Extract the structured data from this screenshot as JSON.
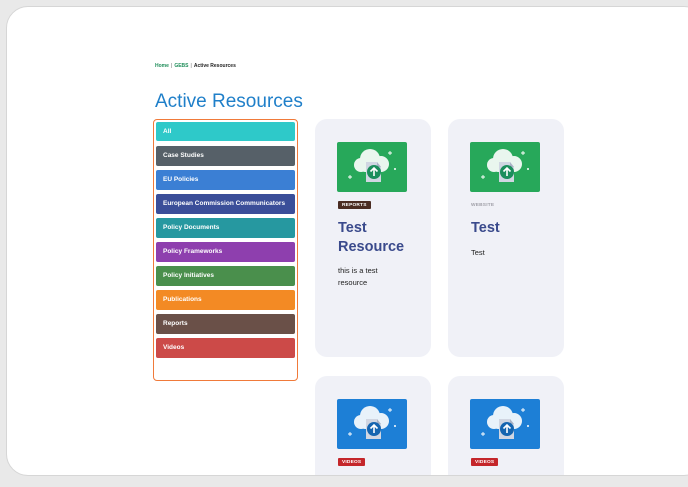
{
  "breadcrumb": {
    "home": "Home",
    "section": "GEBS",
    "current": "Active Resources",
    "separator": "|"
  },
  "page": {
    "title": "Active Resources"
  },
  "filters": [
    {
      "label": "All",
      "color": "#2ec9c9"
    },
    {
      "label": "Case Studies",
      "color": "#566068"
    },
    {
      "label": "EU Policies",
      "color": "#3b7fd4"
    },
    {
      "label": "European Commission Communicators",
      "color": "#3b4e99"
    },
    {
      "label": "Policy Documents",
      "color": "#2698a0"
    },
    {
      "label": "Policy Frameworks",
      "color": "#8e3fae"
    },
    {
      "label": "Policy Initiatives",
      "color": "#4a8f4c"
    },
    {
      "label": "Publications",
      "color": "#f38a24"
    },
    {
      "label": "Reports",
      "color": "#6a5048"
    },
    {
      "label": "Videos",
      "color": "#cc4a48"
    }
  ],
  "cards": [
    {
      "badge": "REPORTS",
      "badge_color": "#4a2c22",
      "thumb_color": "#27a85a",
      "title_line1": "Test",
      "title_line2": "Resource",
      "desc_line1": "this is a test",
      "desc_line2": "resource"
    },
    {
      "badge": "WEBSITE",
      "badge_color": "transparent",
      "thumb_color": "#27a85a",
      "title_line1": "Test",
      "title_line2": "",
      "desc_line1": "Test",
      "desc_line2": ""
    },
    {
      "badge": "VIDEOS",
      "badge_color": "#c4262a",
      "thumb_color": "#1d7fd6"
    },
    {
      "badge": "VIDEOS",
      "badge_color": "#c4262a",
      "thumb_color": "#1d7fd6"
    }
  ],
  "icons": {
    "thumbnail": "cloud-upload-icon"
  }
}
